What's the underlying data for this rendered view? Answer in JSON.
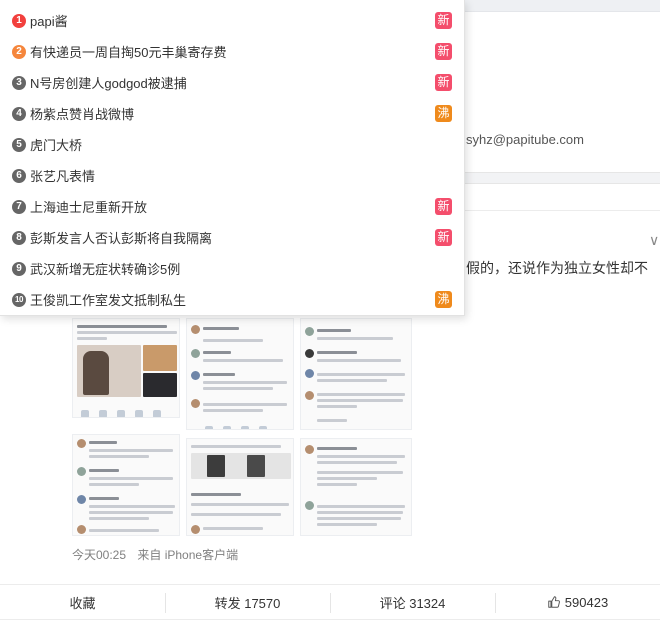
{
  "background": {
    "email": "syhz@papitube.com",
    "post_text": "假的，还说作为独立女性却不",
    "meta": {
      "time": "今天00:25",
      "source": "来自 iPhone客户端"
    },
    "actions": {
      "collect": "收藏",
      "repost": "转发 17570",
      "comment": "评论 31324",
      "like": "590423"
    }
  },
  "hot_search": {
    "items": [
      {
        "rank": "1",
        "text": "papi酱",
        "badge": "新",
        "badge_type": "new",
        "rank_color": "#f2403d"
      },
      {
        "rank": "2",
        "text": "有快递员一周自掏50元丰巢寄存费",
        "badge": "新",
        "badge_type": "new",
        "rank_color": "#f5863c"
      },
      {
        "rank": "3",
        "text": "N号房创建人godgod被逮捕",
        "badge": "新",
        "badge_type": "new",
        "rank_color": "#666666"
      },
      {
        "rank": "4",
        "text": "杨紫点赞肖战微博",
        "badge": "沸",
        "badge_type": "hot",
        "rank_color": "#666666"
      },
      {
        "rank": "5",
        "text": "虎门大桥",
        "badge": "",
        "badge_type": "",
        "rank_color": "#666666"
      },
      {
        "rank": "6",
        "text": "张艺凡表情",
        "badge": "",
        "badge_type": "",
        "rank_color": "#666666"
      },
      {
        "rank": "7",
        "text": "上海迪士尼重新开放",
        "badge": "新",
        "badge_type": "new",
        "rank_color": "#666666"
      },
      {
        "rank": "8",
        "text": "彭斯发言人否认彭斯将自我隔离",
        "badge": "新",
        "badge_type": "new",
        "rank_color": "#666666"
      },
      {
        "rank": "9",
        "text": "武汉新增无症状转确诊5例",
        "badge": "",
        "badge_type": "",
        "rank_color": "#666666"
      },
      {
        "rank": "10",
        "text": "王俊凯工作室发文抵制私生",
        "badge": "沸",
        "badge_type": "hot",
        "rank_color": "#666666"
      }
    ]
  },
  "colors": {
    "badge_new": "#f44e6c",
    "badge_hot": "#ef8a1c",
    "rank_top1": "#f2403d",
    "rank_top2": "#f5863c",
    "rank_default": "#666666"
  }
}
